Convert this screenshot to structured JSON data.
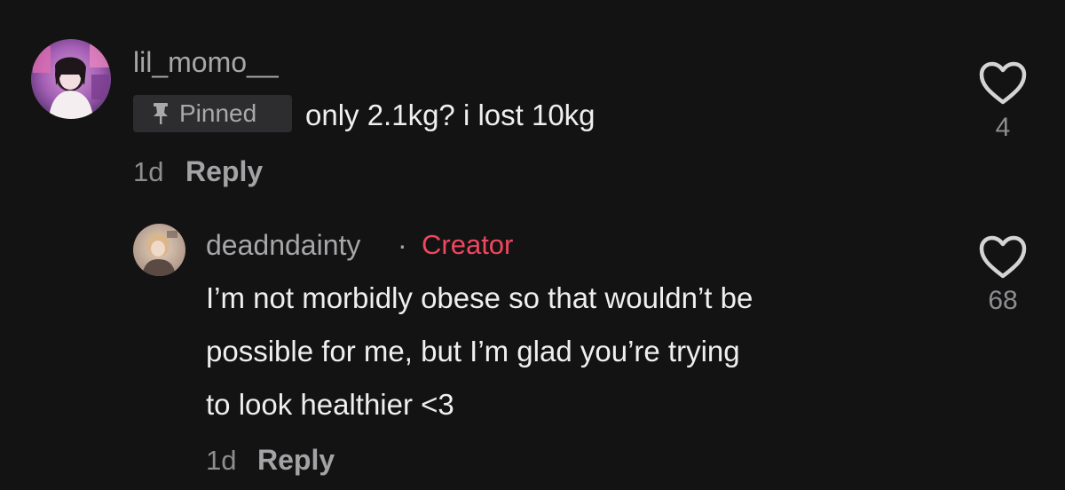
{
  "comments": [
    {
      "username": "lil_momo__",
      "pinned_label": "Pinned",
      "text": "only 2.1kg? i lost 10kg",
      "time": "1d",
      "reply_label": "Reply",
      "likes": "4",
      "avatar_icon": "avatar-icon",
      "like_icon": "heart-outline-icon",
      "pin_icon": "pin-icon"
    }
  ],
  "replies": [
    {
      "username": "deadndainty",
      "separator": "·",
      "creator_label": "Creator",
      "text_lines": [
        "I’m not morbidly obese so that wouldn’t be",
        "possible for me, but I’m glad you’re trying",
        "to look healthier <3"
      ],
      "time": "1d",
      "reply_label": "Reply",
      "likes": "68",
      "avatar_icon": "avatar-icon",
      "like_icon": "heart-outline-icon"
    }
  ],
  "colors": {
    "background": "#131314",
    "username": "#a7a7a9",
    "comment_text": "#efefef",
    "creator_accent": "#f0475f",
    "pinned_badge_bg": "#2d2d30",
    "meta": "#8e8e91"
  }
}
